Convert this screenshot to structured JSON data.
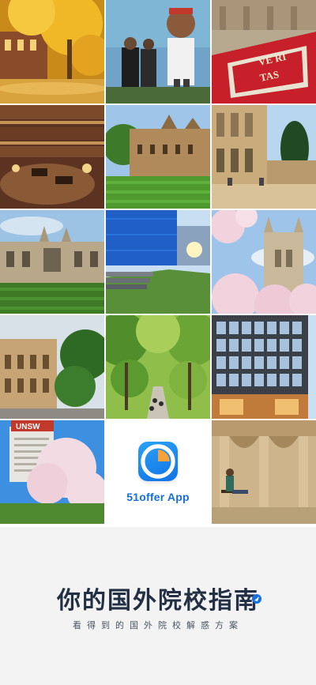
{
  "app": {
    "name": "51offer App",
    "icon": "pie-clock-icon",
    "brand_color": "#1670e0"
  },
  "footer": {
    "headline": "你的国外院校指南",
    "subline": "看得到的国外院校解惑方案"
  },
  "photo_tiles": [
    {
      "name": "autumn-ginkgo-campus",
      "icon": "photo-icon"
    },
    {
      "name": "students-mural-wall",
      "icon": "photo-icon"
    },
    {
      "name": "university-crest-banner",
      "icon": "photo-icon"
    },
    {
      "name": "library-reading-room",
      "icon": "photo-icon"
    },
    {
      "name": "sandstone-quadrangle",
      "icon": "photo-icon"
    },
    {
      "name": "gothic-cloister-lawn",
      "icon": "photo-icon"
    },
    {
      "name": "gothic-college-facade",
      "icon": "photo-icon"
    },
    {
      "name": "modern-glass-building",
      "icon": "photo-icon"
    },
    {
      "name": "blossom-cathedral-tower",
      "icon": "photo-icon"
    },
    {
      "name": "classical-building-trees",
      "icon": "photo-icon"
    },
    {
      "name": "tree-lined-walkway",
      "icon": "photo-icon"
    },
    {
      "name": "modern-brick-building",
      "icon": "photo-icon"
    },
    {
      "name": "unsw-magnolia-tree",
      "icon": "photo-icon"
    },
    {
      "name": "arcade-reading-student",
      "icon": "photo-icon"
    }
  ],
  "photo_texts": {
    "crest_banner_top": "VE RI",
    "crest_banner_bottom": "TAS",
    "unsw_sign": "UNSW"
  }
}
